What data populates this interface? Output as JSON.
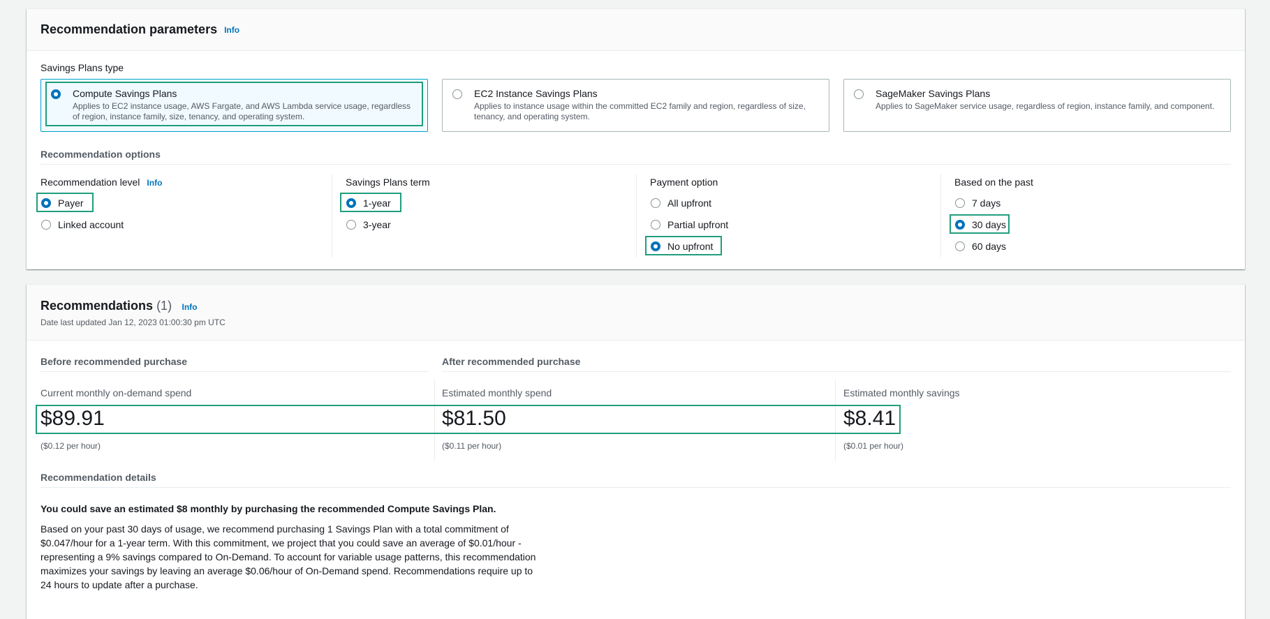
{
  "params": {
    "title": "Recommendation parameters",
    "info": "Info",
    "savings_plans_type_label": "Savings Plans type",
    "types": [
      {
        "title": "Compute Savings Plans",
        "desc": "Applies to EC2 instance usage, AWS Fargate, and AWS Lambda service usage, regardless of region, instance family, size, tenancy, and operating system.",
        "selected": true
      },
      {
        "title": "EC2 Instance Savings Plans",
        "desc": "Applies to instance usage within the committed EC2 family and region, regardless of size, tenancy, and operating system.",
        "selected": false
      },
      {
        "title": "SageMaker Savings Plans",
        "desc": "Applies to SageMaker service usage, regardless of region, instance family, and component.",
        "selected": false
      }
    ],
    "options_title": "Recommendation options",
    "level": {
      "label": "Recommendation level",
      "info": "Info",
      "options": [
        "Payer",
        "Linked account"
      ],
      "selected": "Payer"
    },
    "term": {
      "label": "Savings Plans term",
      "options": [
        "1-year",
        "3-year"
      ],
      "selected": "1-year"
    },
    "payment": {
      "label": "Payment option",
      "options": [
        "All upfront",
        "Partial upfront",
        "No upfront"
      ],
      "selected": "No upfront"
    },
    "past": {
      "label": "Based on the past",
      "options": [
        "7 days",
        "30 days",
        "60 days"
      ],
      "selected": "30 days"
    }
  },
  "recs": {
    "title": "Recommendations",
    "count": "(1)",
    "info": "Info",
    "updated": "Date last updated Jan 12, 2023 01:00:30 pm UTC",
    "before_title": "Before recommended purchase",
    "after_title": "After recommended purchase",
    "metrics": [
      {
        "label": "Current monthly on-demand spend",
        "value": "$89.91",
        "hourly": "($0.12 per hour)"
      },
      {
        "label": "Estimated monthly spend",
        "value": "$81.50",
        "hourly": "($0.11 per hour)"
      },
      {
        "label": "Estimated monthly savings",
        "value": "$8.41",
        "hourly": "($0.01 per hour)"
      }
    ],
    "details_title": "Recommendation details",
    "headline": "You could save an estimated $8 monthly by purchasing the recommended Compute Savings Plan.",
    "body": "Based on your past 30 days of usage, we recommend purchasing 1 Savings Plan with a total commitment of $0.047/hour for a 1-year term. With this commitment, we project that you could save an average of $0.01/hour - representing a 9% savings compared to On-Demand. To account for variable usage patterns, this recommendation maximizes your savings by leaving an average $0.06/hour of On-Demand spend. Recommendations require up to 24 hours to update after a purchase."
  },
  "colors": {
    "accent": "#0073bb",
    "highlight": "#1f9e7d"
  }
}
